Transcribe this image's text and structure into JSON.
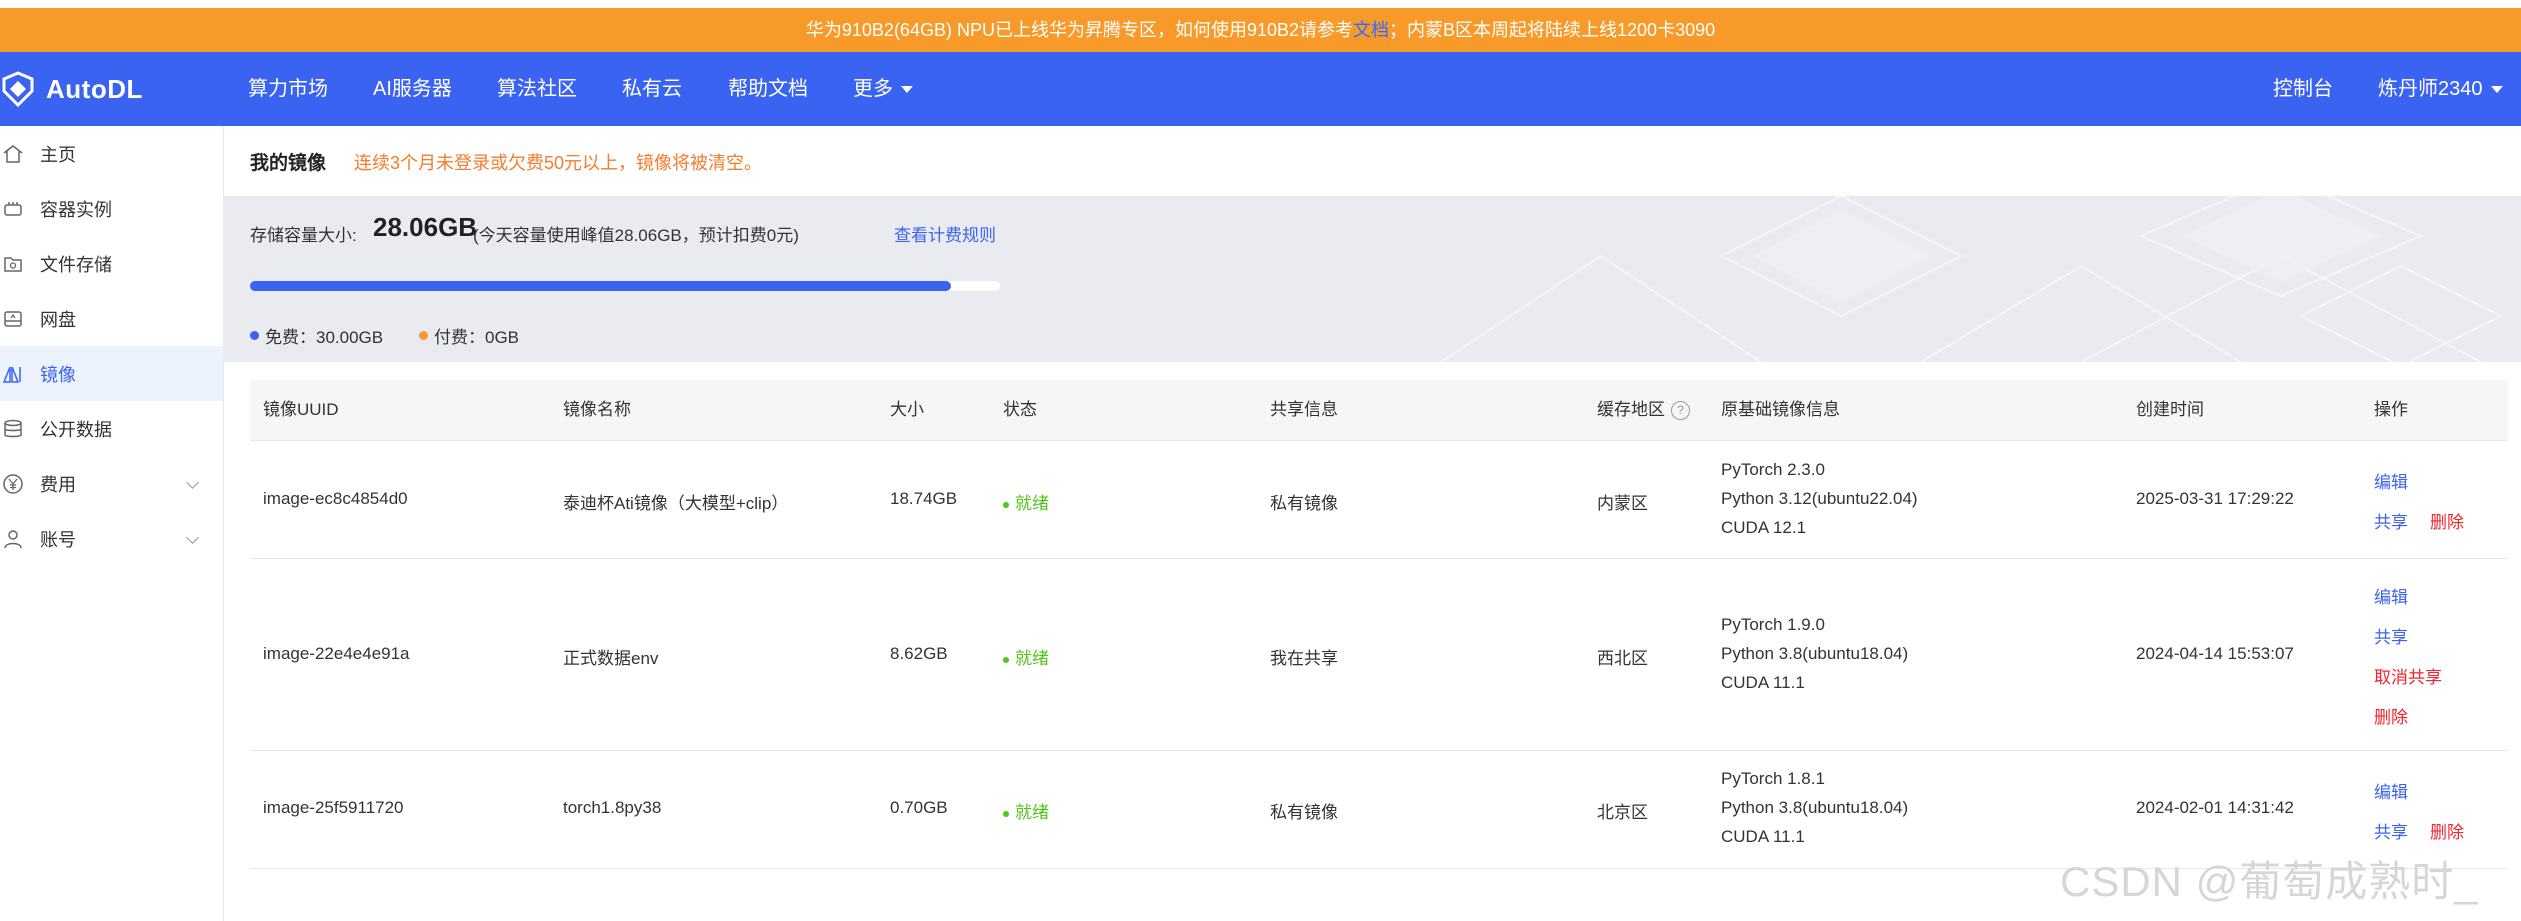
{
  "notice": {
    "before": "华为910B2(64GB) NPU已上线华为昇腾专区，如何使用910B2请参考",
    "link": "文档",
    "after": "；内蒙B区本周起将陆续上线1200卡3090"
  },
  "navbar": {
    "logo": "AutoDL",
    "items": [
      "算力市场",
      "AI服务器",
      "算法社区",
      "私有云",
      "帮助文档",
      "更多"
    ],
    "console": "控制台",
    "user": "炼丹师2340"
  },
  "sidebar": {
    "items": [
      {
        "label": "主页",
        "icon": "home-icon"
      },
      {
        "label": "容器实例",
        "icon": "container-icon"
      },
      {
        "label": "文件存储",
        "icon": "folder-icon"
      },
      {
        "label": "网盘",
        "icon": "disk-icon"
      },
      {
        "label": "镜像",
        "icon": "image-icon"
      },
      {
        "label": "公开数据",
        "icon": "database-icon"
      },
      {
        "label": "费用",
        "icon": "yen-icon"
      },
      {
        "label": "账号",
        "icon": "user-icon"
      }
    ]
  },
  "main": {
    "title": "我的镜像",
    "warning": "连续3个月未登录或欠费50元以上，镜像将被清空。"
  },
  "storage": {
    "label": "存储容量大小:",
    "size": "28.06GB",
    "peak": "(今天容量使用峰值28.06GB，预计扣费0元)",
    "rule_link": "查看计费规则",
    "usage_fraction": 0.935,
    "free": "免费：30.00GB",
    "paid": "付费：0GB"
  },
  "table": {
    "headers": [
      "镜像UUID",
      "镜像名称",
      "大小",
      "状态",
      "共享信息",
      "缓存地区",
      "原基础镜像信息",
      "创建时间",
      "操作"
    ],
    "rows": [
      {
        "uuid": "image-ec8c4854d0",
        "name": "泰迪杯Ati镜像（大模型+clip）",
        "size": "18.74GB",
        "status": "就绪",
        "share": "私有镜像",
        "region": "内蒙区",
        "base": [
          "PyTorch  2.3.0",
          "Python  3.12(ubuntu22.04)",
          "CUDA  12.1"
        ],
        "created": "2025-03-31 17:29:22",
        "actions": [
          "编辑",
          "共享",
          "删除"
        ]
      },
      {
        "uuid": "image-22e4e4e91a",
        "name": "正式数据env",
        "size": "8.62GB",
        "status": "就绪",
        "share": "我在共享",
        "region": "西北区",
        "base": [
          "PyTorch  1.9.0",
          "Python  3.8(ubuntu18.04)",
          "CUDA  11.1"
        ],
        "created": "2024-04-14 15:53:07",
        "actions": [
          "编辑",
          "共享",
          "取消共享",
          "删除"
        ]
      },
      {
        "uuid": "image-25f5911720",
        "name": "torch1.8py38",
        "size": "0.70GB",
        "status": "就绪",
        "share": "私有镜像",
        "region": "北京区",
        "base": [
          "PyTorch  1.8.1",
          "Python  3.8(ubuntu18.04)",
          "CUDA  11.1"
        ],
        "created": "2024-02-01 14:31:42",
        "actions": [
          "编辑",
          "共享",
          "删除"
        ]
      }
    ]
  },
  "watermark": "CSDN @葡萄成熟时_",
  "colors": {
    "brand": "#3a63f2",
    "notice": "#f89a29",
    "warning": "#f47c2e",
    "success": "#52c41a",
    "danger": "#f5222d",
    "paid_dot": "#f89a29"
  }
}
